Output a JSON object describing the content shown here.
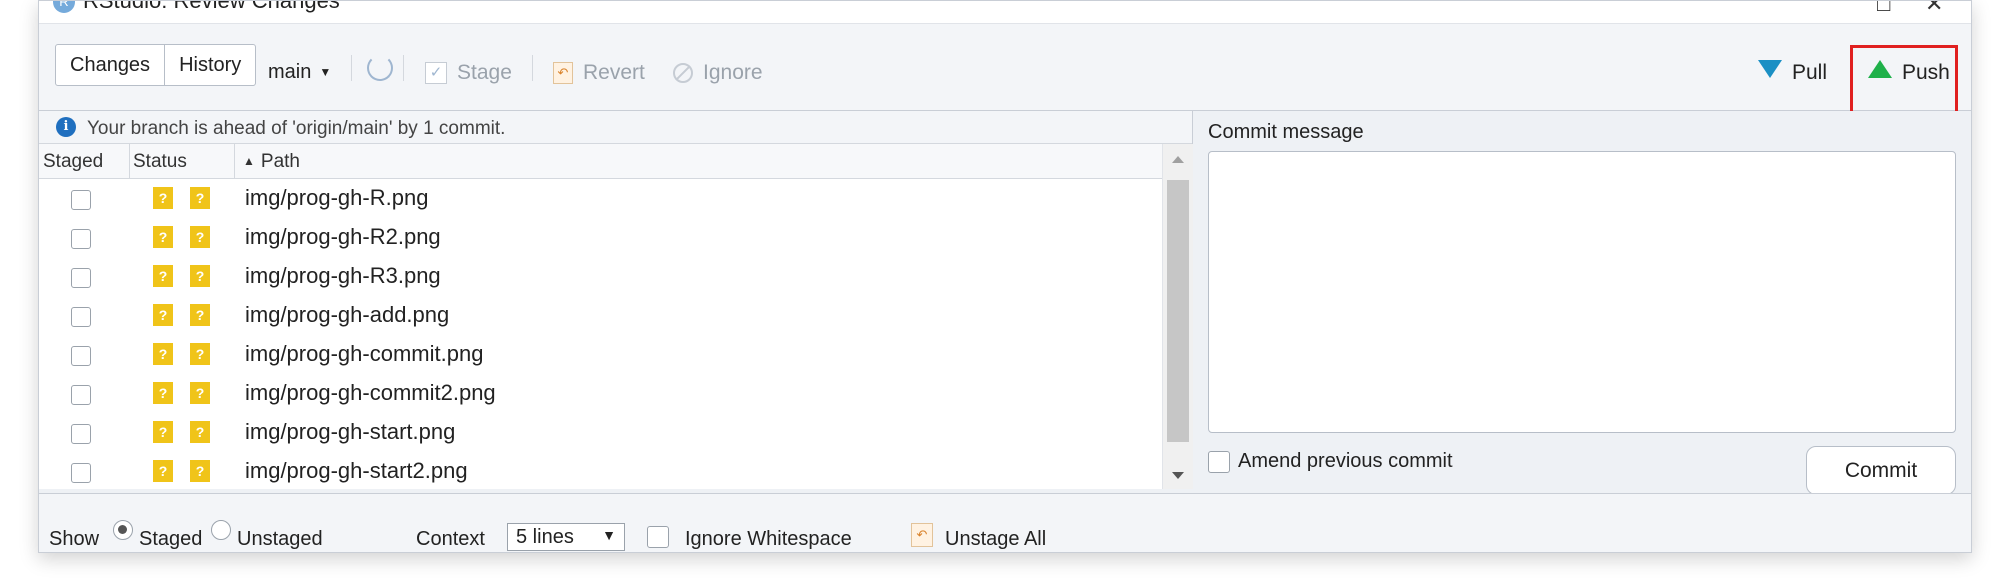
{
  "window": {
    "title": "RStudio: Review Changes",
    "minimize_glyph": "□",
    "close_glyph": "✕"
  },
  "toolbar": {
    "tabs": [
      "Changes",
      "History"
    ],
    "branch": "main",
    "stage_label": "Stage",
    "revert_label": "Revert",
    "ignore_label": "Ignore",
    "pull_label": "Pull",
    "push_label": "Push"
  },
  "info": {
    "message": "Your branch is ahead of 'origin/main' by 1 commit."
  },
  "table": {
    "columns": [
      "Staged",
      "Status",
      "Path"
    ],
    "sort_indicator": "▲",
    "status_badge": "?",
    "rows": [
      {
        "path": "img/prog-gh-R.png"
      },
      {
        "path": "img/prog-gh-R2.png"
      },
      {
        "path": "img/prog-gh-R3.png"
      },
      {
        "path": "img/prog-gh-add.png"
      },
      {
        "path": "img/prog-gh-commit.png"
      },
      {
        "path": "img/prog-gh-commit2.png"
      },
      {
        "path": "img/prog-gh-start.png"
      },
      {
        "path": "img/prog-gh-start2.png"
      }
    ]
  },
  "commit": {
    "message_label": "Commit message",
    "message_value": "",
    "amend_label": "Amend previous commit",
    "commit_button": "Commit"
  },
  "bottom": {
    "show_label": "Show",
    "staged_label": "Staged",
    "unstaged_label": "Unstaged",
    "context_label": "Context",
    "context_value": "5 lines",
    "ignore_whitespace_label": "Ignore Whitespace",
    "unstage_all_label": "Unstage All"
  },
  "colors": {
    "push_highlight": "#e02020",
    "status_badge": "#f0c419",
    "pull_arrow": "#1a8fc4",
    "push_arrow": "#1fb14a",
    "info_icon": "#1f6fbf"
  }
}
